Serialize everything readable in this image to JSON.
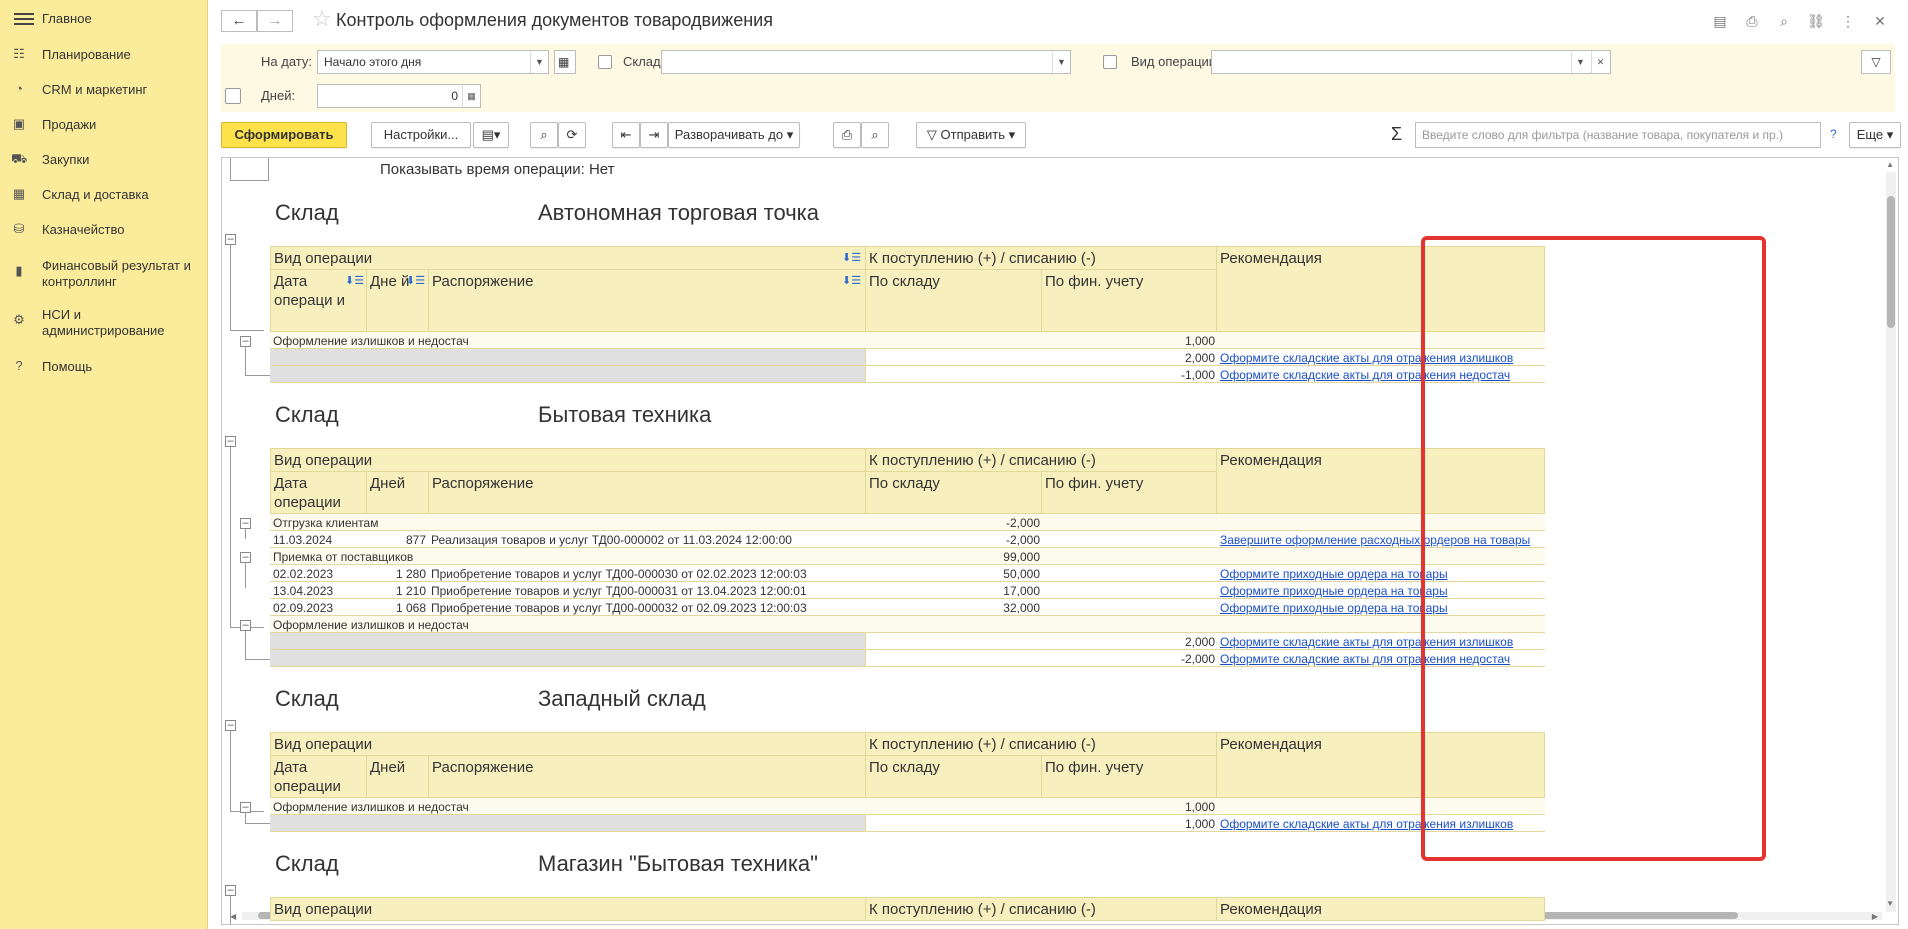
{
  "sidebar": {
    "items": [
      {
        "label": "Главное",
        "icon": "menu-icon"
      },
      {
        "label": "Планирование",
        "icon": "planning-icon"
      },
      {
        "label": "CRM и маркетинг",
        "icon": "crm-icon"
      },
      {
        "label": "Продажи",
        "icon": "sales-bag-icon"
      },
      {
        "label": "Закупки",
        "icon": "cart-icon"
      },
      {
        "label": "Склад и доставка",
        "icon": "warehouse-grid-icon"
      },
      {
        "label": "Казначейство",
        "icon": "treasury-icon"
      },
      {
        "label": "Финансовый результат и контроллинг",
        "icon": "chart-icon"
      },
      {
        "label": "НСИ и администрирование",
        "icon": "gear-icon"
      },
      {
        "label": "Помощь",
        "icon": "help-icon"
      }
    ]
  },
  "header": {
    "title": "Контроль оформления документов товародвижения",
    "back": "←",
    "forward": "→",
    "star": "☆"
  },
  "filters": {
    "date_label": "На дату:",
    "date_value": "Начало этого дня",
    "sklad_label": "Склад:",
    "sklad_value": "",
    "op_label": "Вид операции:",
    "op_value": "",
    "days_label": "Дней:",
    "days_value": "0"
  },
  "toolbar": {
    "generate": "Сформировать",
    "settings": "Настройки...",
    "expand": "Разворачивать до",
    "send": "Отправить",
    "search_placeholder": "Введите слово для фильтра (название товара, покупателя и пр.)",
    "help": "?",
    "more": "Еще",
    "sigma": "Σ"
  },
  "report": {
    "show_time": "Показывать время операции: Нет",
    "sklad_word": "Склад",
    "headers": {
      "vid": "Вид операции",
      "k_post": "К поступлению (+) / списанию (-)",
      "rec": "Рекомендация",
      "date": "Дата операции",
      "date_wrapped": "Дата операци и",
      "days": "Дней",
      "days_wrapped": "Дне й",
      "rasp": "Распоряжение",
      "po_skladu": "По складу",
      "po_fin": "По фин. учету"
    },
    "sections": [
      {
        "name": "Автономная торговая точка",
        "group": "Оформление излишков и недостач",
        "group_fin": "1,000",
        "rows": [
          {
            "fin": "2,000",
            "rec": "Оформите складские акты для отражения излишков"
          },
          {
            "fin": "-1,000",
            "rec": "Оформите складские акты для отражения недостач"
          }
        ]
      },
      {
        "name": "Бытовая техника",
        "groups": [
          {
            "label": "Отгрузка клиентам",
            "sklad": "-2,000",
            "rows": [
              {
                "date": "11.03.2024",
                "days": "877",
                "rasp": "Реализация товаров и услуг ТД00-000002 от 11.03.2024 12:00:00",
                "sklad": "-2,000",
                "rec": "Завершите оформление расходных ордеров на товары"
              }
            ]
          },
          {
            "label": "Приемка от поставщиков",
            "sklad": "99,000",
            "rows": [
              {
                "date": "02.02.2023",
                "days": "1 280",
                "rasp": "Приобретение товаров и услуг ТД00-000030 от 02.02.2023 12:00:03",
                "sklad": "50,000",
                "rec": "Оформите приходные ордера на товары"
              },
              {
                "date": "13.04.2023",
                "days": "1 210",
                "rasp": "Приобретение товаров и услуг ТД00-000031 от 13.04.2023 12:00:01",
                "sklad": "17,000",
                "rec": "Оформите приходные ордера на товары"
              },
              {
                "date": "02.09.2023",
                "days": "1 068",
                "rasp": "Приобретение товаров и услуг ТД00-000032 от 02.09.2023 12:00:03",
                "sklad": "32,000",
                "rec": "Оформите приходные ордера на товары"
              }
            ]
          },
          {
            "label": "Оформление излишков и недостач",
            "rows": [
              {
                "fin": "2,000",
                "rec": "Оформите складские акты для отражения излишков"
              },
              {
                "fin": "-2,000",
                "rec": "Оформите складские акты для отражения недостач"
              }
            ]
          }
        ]
      },
      {
        "name": "Западный склад",
        "group": "Оформление излишков и недостач",
        "group_fin": "1,000",
        "rows": [
          {
            "fin": "1,000",
            "rec": "Оформите складские акты для отражения излишков"
          }
        ]
      },
      {
        "name": "Магазин \"Бытовая техника\""
      }
    ]
  },
  "colors": {
    "sidebar_bg": "#fbec9c",
    "header_bg": "#f7efbe",
    "primary_button": "#fde24c",
    "highlight_box": "#e3342f",
    "link": "#1a4fc8"
  }
}
